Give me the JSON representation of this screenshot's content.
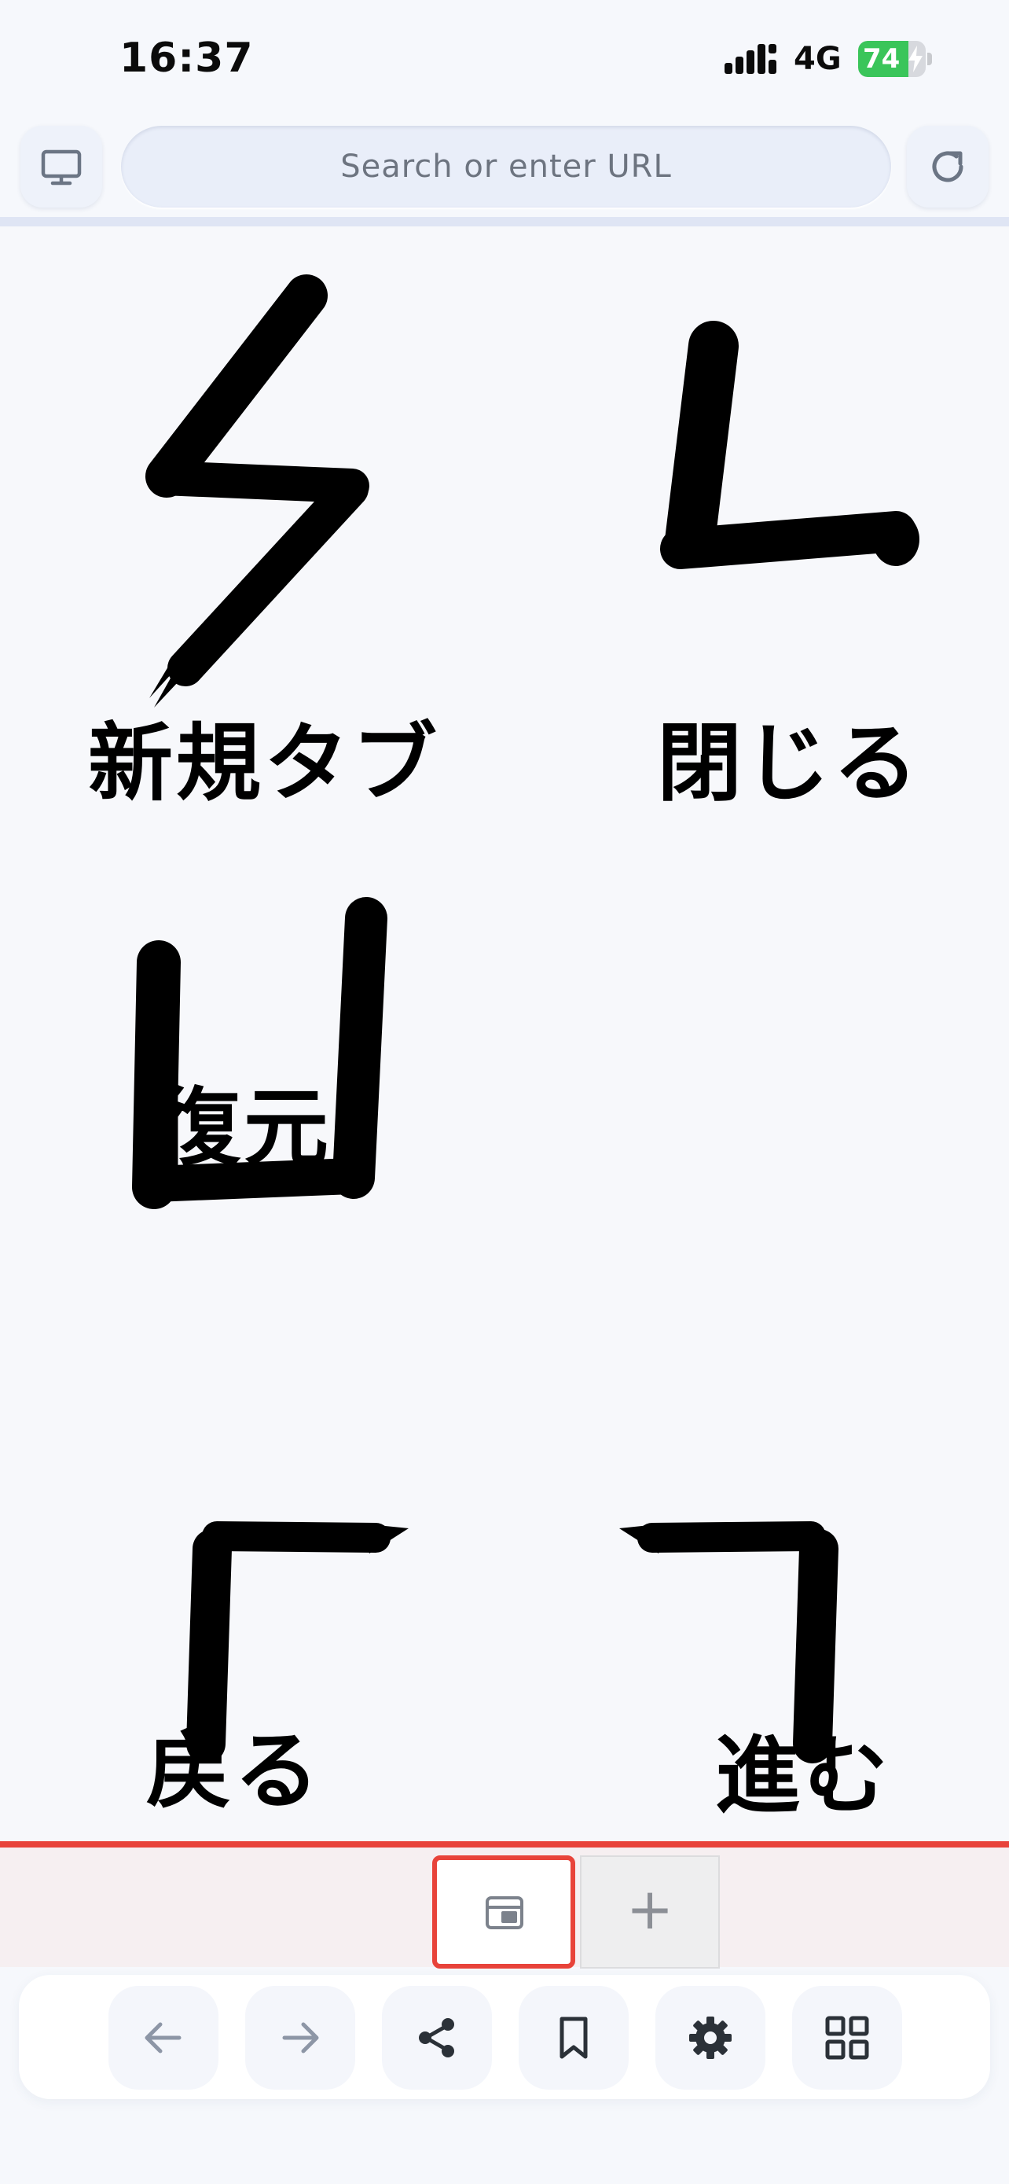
{
  "status_bar": {
    "time": "16:37",
    "network": "4G",
    "battery_percent": "74",
    "battery_level": 0.74,
    "battery_color": "#3ac55a"
  },
  "url_bar": {
    "placeholder": "Search or enter URL",
    "left_icon": "desktop-icon",
    "right_icon": "reload-icon"
  },
  "gestures": [
    {
      "name": "new-tab",
      "label": "新規タブ",
      "icon": "zigzag-down-left-stroke"
    },
    {
      "name": "close",
      "label": "閉じる",
      "icon": "down-right-l-stroke"
    },
    {
      "name": "restore",
      "label": "復元",
      "icon": "u-stroke"
    },
    {
      "name": "back",
      "label": "戻る",
      "icon": "up-right-corner-stroke"
    },
    {
      "name": "forward",
      "label": "進む",
      "icon": "up-left-corner-stroke"
    }
  ],
  "tab_strip": {
    "current_tab_icon": "tab-window-icon",
    "add_tab_glyph": "+",
    "highlight_color": "#e8433a"
  },
  "toolbar": {
    "buttons": [
      {
        "name": "back",
        "icon": "arrow-left-icon"
      },
      {
        "name": "forward",
        "icon": "arrow-right-icon"
      },
      {
        "name": "share",
        "icon": "share-icon"
      },
      {
        "name": "bookmark",
        "icon": "bookmark-icon"
      },
      {
        "name": "settings",
        "icon": "gear-icon"
      },
      {
        "name": "tabs-grid",
        "icon": "grid-icon"
      }
    ]
  }
}
